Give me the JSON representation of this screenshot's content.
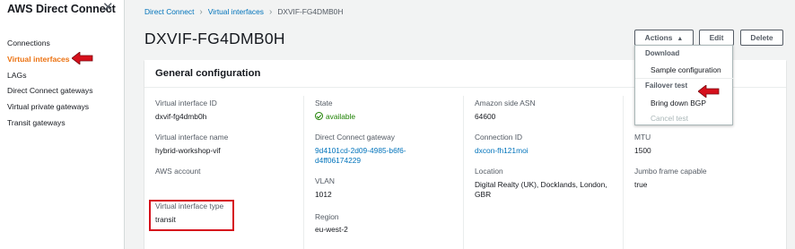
{
  "sidebar": {
    "title": "AWS Direct Connect",
    "items": [
      {
        "label": "Connections"
      },
      {
        "label": "Virtual interfaces"
      },
      {
        "label": "LAGs"
      },
      {
        "label": "Direct Connect gateways"
      },
      {
        "label": "Virtual private gateways"
      },
      {
        "label": "Transit gateways"
      }
    ]
  },
  "breadcrumb": {
    "items": [
      "Direct Connect",
      "Virtual interfaces",
      "DXVIF-FG4DMB0H"
    ]
  },
  "page": {
    "title": "DXVIF-FG4DMB0H"
  },
  "toolbar": {
    "actions_label": "Actions",
    "edit_label": "Edit",
    "delete_label": "Delete"
  },
  "actions_menu": {
    "download_group": "Download",
    "sample_configuration": "Sample configuration",
    "failover_group": "Failover test",
    "bring_down_bgp": "Bring down BGP",
    "cancel_test": "Cancel test"
  },
  "general": {
    "title": "General configuration",
    "vif_id_label": "Virtual interface ID",
    "vif_id": "dxvif-fg4dmb0h",
    "vif_name_label": "Virtual interface name",
    "vif_name": "hybrid-workshop-vif",
    "aws_account_label": "AWS account",
    "vif_type_label": "Virtual interface type",
    "vif_type": "transit",
    "state_label": "State",
    "state": "available",
    "dcgw_label": "Direct Connect gateway",
    "dcgw_line1": "9d4101cd-2d09-4985-b6f6-",
    "dcgw_line2": "d4ff06174229",
    "vlan_label": "VLAN",
    "vlan": "1012",
    "region_label": "Region",
    "region": "eu-west-2",
    "asn_label": "Amazon side ASN",
    "asn": "64600",
    "connection_id_label": "Connection ID",
    "connection_id": "dxcon-fh121moi",
    "location_label": "Location",
    "location_line1": "Digital Realty (UK), Docklands, London,",
    "location_line2": "GBR",
    "mtu_label": "MTU",
    "mtu": "1500",
    "jumbo_label": "Jumbo frame capable",
    "jumbo": "true"
  },
  "colors": {
    "accent": "#ec7211",
    "link": "#0073bb",
    "success": "#1d8102",
    "annotation_red": "#d6101c"
  }
}
